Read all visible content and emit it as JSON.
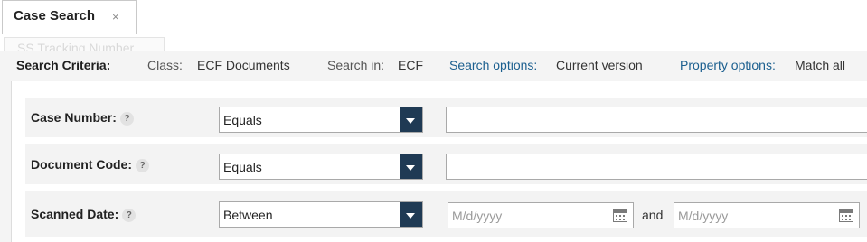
{
  "tabs": [
    {
      "label": "Case Search",
      "close_glyph": "×"
    }
  ],
  "ghost_drag_label": "SS Tracking Number",
  "criteria": {
    "title": "Search Criteria:",
    "class_key": "Class:",
    "class_value": "ECF Documents",
    "search_in_key": "Search in:",
    "search_in_value": "ECF",
    "search_options_key": "Search options:",
    "search_options_value": "Current version",
    "property_options_key": "Property options:",
    "property_options_value": "Match all"
  },
  "fields": [
    {
      "label": "Case Number:",
      "help": "?",
      "operator": "Equals",
      "value": ""
    },
    {
      "label": "Document Code:",
      "help": "?",
      "operator": "Equals",
      "value": ""
    },
    {
      "label": "Scanned Date:",
      "help": "?",
      "operator": "Between",
      "from_placeholder": "M/d/yyyy",
      "joiner": "and",
      "to_placeholder": "M/d/yyyy"
    }
  ],
  "colors": {
    "link": "#1b5f8f",
    "dropdown_button": "#1f3a54",
    "row_background": "#f3f3f3"
  },
  "icons": {
    "tab_close": "close-icon",
    "help": "help-icon",
    "dropdown": "chevron-down-icon",
    "date_picker": "calendar-icon"
  }
}
